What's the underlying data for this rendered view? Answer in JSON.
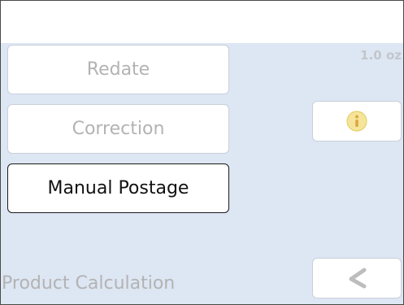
{
  "menu": {
    "redate_label": "Redate",
    "correction_label": "Correction",
    "manual_postage_label": "Manual Postage",
    "product_calculation_label": "Product Calculation"
  },
  "status": {
    "weight": "1.0 oz"
  },
  "icons": {
    "info": "info-icon",
    "back": "back-arrow-icon"
  },
  "colors": {
    "content_background": "#dde6f3",
    "disabled_text": "#b3b3b3",
    "active_border": "#1a1a1a",
    "info_icon_fill": "#f2e08a"
  }
}
